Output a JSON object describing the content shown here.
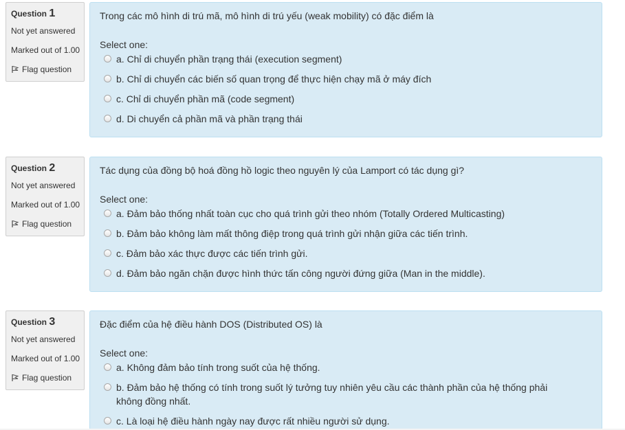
{
  "questions": [
    {
      "label": "Question",
      "number": "1",
      "state": "Not yet answered",
      "grade": "Marked out of 1.00",
      "flag_label": "Flag question",
      "text": "Trong các mô hình di trú mã, mô hình di trú yếu (weak mobility) có đặc điểm là",
      "prompt": "Select one:",
      "options": [
        "a. Chỉ di chuyển phần trạng thái (execution segment)",
        "b. Chỉ di chuyển các biến số quan trọng để thực hiện chạy mã ở máy đích",
        "c. Chỉ di chuyển phần mã (code segment)",
        "d. Di chuyển cả phần mã và phần trạng thái"
      ]
    },
    {
      "label": "Question",
      "number": "2",
      "state": "Not yet answered",
      "grade": "Marked out of 1.00",
      "flag_label": "Flag question",
      "text": "Tác dụng của đồng bộ hoá đồng hồ logic theo nguyên lý của Lamport có tác dụng gì?",
      "prompt": "Select one:",
      "options": [
        "a. Đảm bảo thống nhất toàn cục cho quá trình gửi theo nhóm (Totally Ordered Multicasting)",
        "b. Đảm bảo không làm mất thông điệp trong quá trình gửi nhận giữa các tiến trình.",
        "c. Đảm bảo xác thực được các tiến trình gửi.",
        "d. Đảm bảo ngăn chặn được hình thức tấn công người đứng giữa (Man in the middle)."
      ]
    },
    {
      "label": "Question",
      "number": "3",
      "state": "Not yet answered",
      "grade": "Marked out of 1.00",
      "flag_label": "Flag question",
      "text": "Đặc điểm của hệ điều hành DOS (Distributed OS) là",
      "prompt": "Select one:",
      "options": [
        "a. Không đảm bảo tính trong suốt của hệ thống.",
        "b. Đảm bảo hệ thống có tính trong suốt lý tưởng tuy nhiên yêu cầu các thành phần của hệ thống phải không đồng nhất.",
        "c. Là loại hệ điều hành ngày nay được rất nhiều người sử dụng."
      ]
    }
  ],
  "colors": {
    "info_bg": "#f0f0f0",
    "content_bg": "#d9ebf5",
    "content_border": "#bcdff1"
  },
  "icons": {
    "flag": "flag-icon",
    "radio": "radio-unchecked-icon"
  }
}
